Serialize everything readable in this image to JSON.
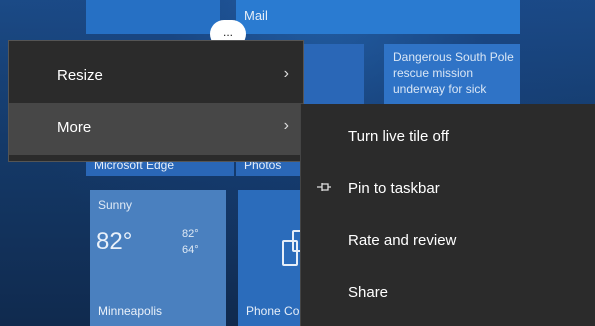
{
  "tiles": {
    "mail_label": "Mail",
    "news_text": "Dangerous South Pole rescue mission underway for sick",
    "edge_label": "Microsoft Edge",
    "photos_label": "Photos",
    "weather": {
      "condition": "Sunny",
      "temp": "82°",
      "high": "82°",
      "low": "64°",
      "city": "Minneapolis"
    },
    "phone_label": "Phone Co"
  },
  "more_button": {
    "glyph": "..."
  },
  "menu1": {
    "items": [
      {
        "label": "Resize",
        "chevron": "›"
      },
      {
        "label": "More",
        "chevron": "›"
      }
    ]
  },
  "submenu": {
    "items": [
      {
        "label": "Turn live tile off"
      },
      {
        "label": "Pin to taskbar",
        "icon": "pin-icon"
      },
      {
        "label": "Rate and review"
      },
      {
        "label": "Share"
      }
    ]
  },
  "colors": {
    "menu_bg": "#2b2b2b",
    "menu_hover": "#474747",
    "tile_blue": "#2a67b7"
  }
}
